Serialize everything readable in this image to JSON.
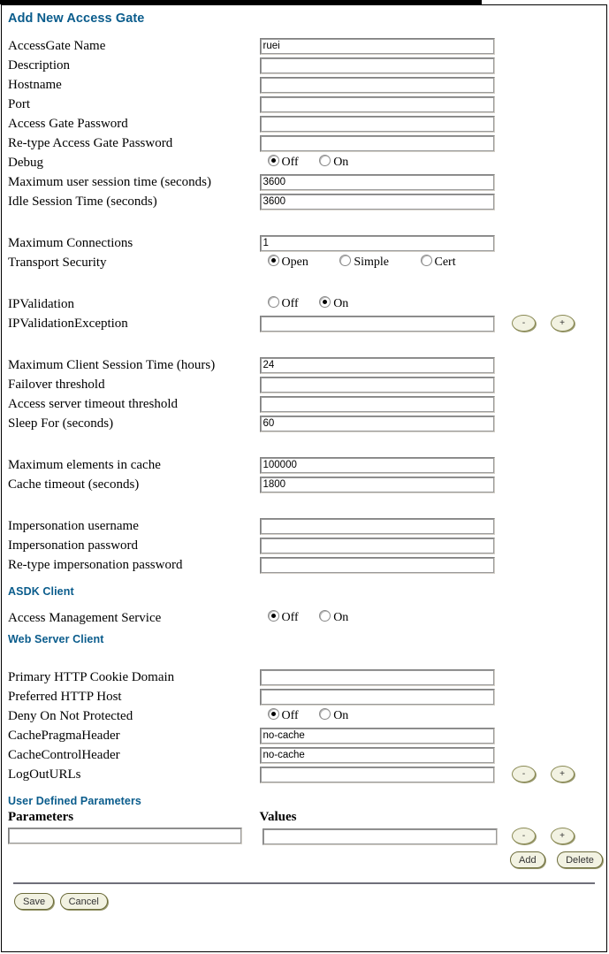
{
  "page": {
    "title": "Add New Access Gate"
  },
  "groups": [
    {
      "fields": [
        {
          "type": "text",
          "label": "AccessGate Name",
          "value": "ruei"
        },
        {
          "type": "text",
          "label": "Description",
          "value": ""
        },
        {
          "type": "text",
          "label": "Hostname",
          "value": ""
        },
        {
          "type": "text",
          "label": "Port",
          "value": ""
        },
        {
          "type": "text",
          "label": "Access Gate Password",
          "value": ""
        },
        {
          "type": "text",
          "label": "Re-type Access Gate Password",
          "value": ""
        },
        {
          "type": "radio",
          "label": "Debug",
          "options": [
            "Off",
            "On"
          ],
          "selected": "Off"
        },
        {
          "type": "text",
          "label": "Maximum user session time (seconds)",
          "value": "3600"
        },
        {
          "type": "text",
          "label": "Idle Session Time (seconds)",
          "value": "3600"
        }
      ]
    },
    {
      "fields": [
        {
          "type": "text",
          "label": "Maximum Connections",
          "value": "1"
        },
        {
          "type": "radio",
          "label": "Transport Security",
          "options": [
            "Open",
            "Simple",
            "Cert"
          ],
          "selected": "Open"
        }
      ]
    },
    {
      "fields": [
        {
          "type": "radio",
          "label": "IPValidation",
          "options": [
            "Off",
            "On"
          ],
          "selected": "On"
        },
        {
          "type": "text-pm",
          "label": "IPValidationException",
          "value": ""
        }
      ]
    },
    {
      "fields": [
        {
          "type": "text",
          "label": "Maximum Client Session Time (hours)",
          "value": "24"
        },
        {
          "type": "text",
          "label": "Failover threshold",
          "value": ""
        },
        {
          "type": "text",
          "label": "Access server timeout threshold",
          "value": ""
        },
        {
          "type": "text",
          "label": "Sleep For (seconds)",
          "value": "60"
        }
      ]
    },
    {
      "fields": [
        {
          "type": "text",
          "label": "Maximum elements in cache",
          "value": "100000"
        },
        {
          "type": "text",
          "label": "Cache timeout (seconds)",
          "value": "1800"
        }
      ]
    },
    {
      "fields": [
        {
          "type": "text",
          "label": "Impersonation username",
          "value": ""
        },
        {
          "type": "text",
          "label": "Impersonation password",
          "value": ""
        },
        {
          "type": "text",
          "label": "Re-type impersonation password",
          "value": ""
        }
      ]
    }
  ],
  "asdk_section": {
    "heading": "ASDK Client",
    "fields": [
      {
        "type": "radio",
        "label": "Access Management Service",
        "options": [
          "Off",
          "On"
        ],
        "selected": "Off"
      }
    ]
  },
  "web_section": {
    "heading": "Web Server Client",
    "fields": [
      {
        "type": "text",
        "label": "Primary HTTP Cookie Domain",
        "value": ""
      },
      {
        "type": "text",
        "label": "Preferred HTTP Host",
        "value": ""
      },
      {
        "type": "radio",
        "label": "Deny On Not Protected",
        "options": [
          "Off",
          "On"
        ],
        "selected": "Off"
      },
      {
        "type": "text",
        "label": "CachePragmaHeader",
        "value": "no-cache"
      },
      {
        "type": "text",
        "label": "CacheControlHeader",
        "value": "no-cache"
      },
      {
        "type": "text-pm",
        "label": "LogOutURLs",
        "value": ""
      }
    ]
  },
  "udp_section": {
    "heading": "User Defined Parameters",
    "col_parameters": "Parameters",
    "col_values": "Values",
    "parameter_value": "",
    "value_value": "",
    "minus_label": "-",
    "plus_label": "+",
    "add_label": "Add",
    "delete_label": "Delete"
  },
  "footer": {
    "save_label": "Save",
    "cancel_label": "Cancel"
  },
  "stepper": {
    "minus_label": "-",
    "plus_label": "+"
  },
  "colors": {
    "heading_blue": "#0a5c8c",
    "button_face": "#f2f2e2",
    "button_border": "#6b6b3a",
    "rule": "#6f6f7a"
  }
}
